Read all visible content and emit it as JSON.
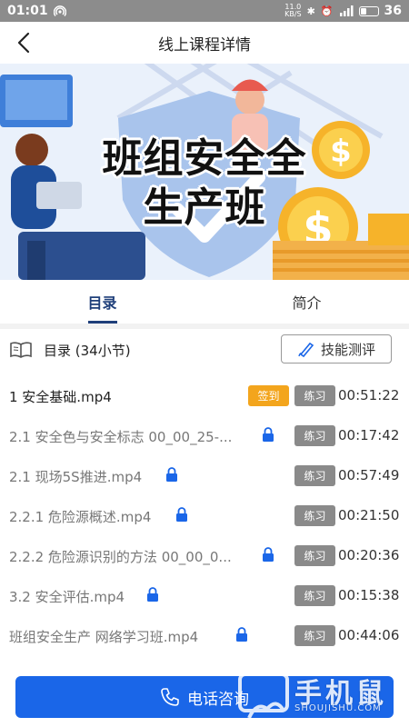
{
  "status_bar": {
    "time": "01:01",
    "net_speed_value": "11.0",
    "net_speed_unit": "KB/S",
    "battery": "36"
  },
  "nav": {
    "title": "线上课程详情"
  },
  "banner": {
    "title_line1": "班组安全全",
    "title_line2": "生产班"
  },
  "tabs": [
    {
      "label": "目录",
      "active": true
    },
    {
      "label": "简介",
      "active": false
    }
  ],
  "toc": {
    "label": "目录 (34小节)",
    "skill_button": "技能测评"
  },
  "lessons": [
    {
      "name": "1 安全基础.mp4",
      "sign": "签到",
      "practice": "练习",
      "duration": "00:51:22"
    },
    {
      "name": "2.1 安全色与安全标志 00_00_25-...",
      "practice": "练习",
      "duration": "00:17:42"
    },
    {
      "name": "2.1 现场5S推进.mp4",
      "practice": "练习",
      "duration": "00:57:49"
    },
    {
      "name": "2.2.1 危险源概述.mp4",
      "practice": "练习",
      "duration": "00:21:50"
    },
    {
      "name": "2.2.2 危险源识别的方法 00_00_0...",
      "practice": "练习",
      "duration": "00:20:36"
    },
    {
      "name": "3.2 安全评估.mp4",
      "practice": "练习",
      "duration": "00:15:38"
    },
    {
      "name": "班组安全生产 网络学习班.mp4",
      "practice": "练习",
      "duration": "00:44:06"
    }
  ],
  "footer": {
    "call_button": "电话咨询"
  },
  "watermark": {
    "text": "手机鼠",
    "url": "SHOUJISHU.COM"
  },
  "colors": {
    "primary": "#1a66e8",
    "tab_active": "#1f3f7a",
    "sign_badge": "#f3a51d",
    "practice_badge": "#8a8a8a",
    "lock": "#1a66e8"
  }
}
